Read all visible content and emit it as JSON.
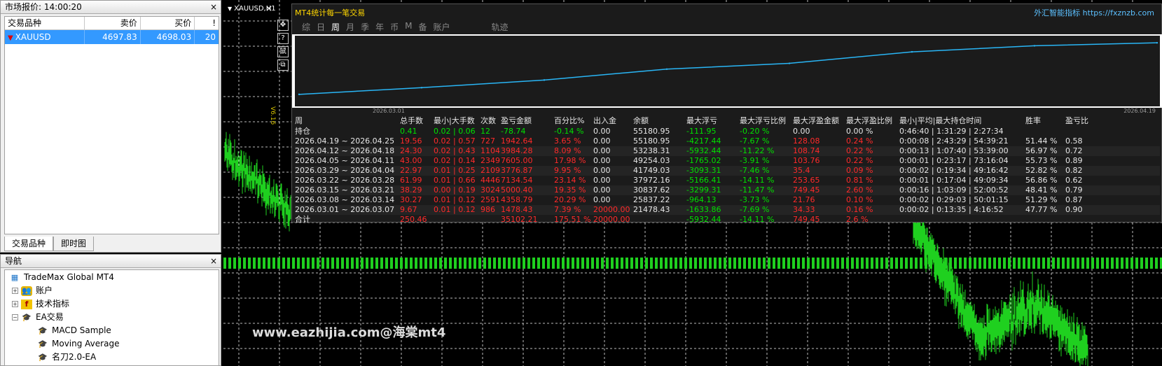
{
  "market": {
    "title": "市场报价: 14:00:20",
    "close": "×",
    "cols": [
      "交易品种",
      "卖价",
      "买价",
      "!"
    ],
    "row": {
      "symbol": "XAUUSD",
      "bid": "4697.83",
      "ask": "4698.03",
      "spread": "20"
    },
    "tabs": [
      "交易品种",
      "即时图"
    ]
  },
  "nav": {
    "title": "导航",
    "close": "×",
    "root": "TradeMax Global MT4",
    "account": "账户",
    "indicators": "技术指标",
    "ea": "EA交易",
    "ea_items": [
      "MACD Sample",
      "Moving Average",
      "名刀2.0-EA"
    ]
  },
  "chart": {
    "symbol": "XAUUSD,H1",
    "close": "×",
    "version": "V6.16",
    "watermark": "www.eazhijia.com@海棠mt4",
    "tools": [
      "✥",
      "?",
      "鼠",
      "⧉"
    ]
  },
  "stats": {
    "title": "MT4统计每一笔交易",
    "brand": "外汇智能指标 https://fxznzb.com",
    "tabs": [
      "综",
      "日",
      "周",
      "月",
      "季",
      "年",
      "币",
      "M",
      "备",
      "账户"
    ],
    "tab_track": "轨迹",
    "active_tab": "周",
    "date_start": "2026.03.01",
    "date_end": "2026.04.19",
    "headers": [
      "周",
      "总手数",
      "最小|大手数",
      "次数",
      "盈亏金额",
      "百分比%",
      "出入金",
      "余额",
      "最大浮亏",
      "最大浮亏比例",
      "最大浮盈金额",
      "最大浮盈比例",
      "最小|平均|最大持仓时间",
      "胜率",
      "盈亏比"
    ],
    "holding": [
      "持仓",
      "0.41",
      "0.02 | 0.06",
      "12",
      "-78.74",
      "-0.14 %",
      "0.00",
      "55180.95",
      "-111.95",
      "-0.20 %",
      "0.00",
      "0.00 %",
      "0:46:40 | 1:31:29 | 2:27:34",
      "",
      ""
    ],
    "rows": [
      [
        "2026.04.19 ~ 2026.04.25",
        "19.56",
        "0.02 | 0.57",
        "727",
        "1942.64",
        "3.65 %",
        "0.00",
        "55180.95",
        "-4217.44",
        "-7.67 %",
        "128.08",
        "0.24 %",
        "0:00:08 | 2:43:29 | 54:39:21",
        "51.44 %",
        "0.58"
      ],
      [
        "2026.04.12 ~ 2026.04.18",
        "24.30",
        "0.02 | 0.43",
        "1104",
        "3984.28",
        "8.09 %",
        "0.00",
        "53238.31",
        "-5932.44",
        "-11.22 %",
        "108.74",
        "0.22 %",
        "0:00:13 | 1:07:40 | 53:39:00",
        "56.97 %",
        "0.72"
      ],
      [
        "2026.04.05 ~ 2026.04.11",
        "43.00",
        "0.02 | 0.14",
        "2349",
        "7605.00",
        "17.98 %",
        "0.00",
        "49254.03",
        "-1765.02",
        "-3.91 %",
        "103.76",
        "0.22 %",
        "0:00:01 | 0:23:17 | 73:16:04",
        "55.73 %",
        "0.89"
      ],
      [
        "2026.03.29 ~ 2026.04.04",
        "22.97",
        "0.01 | 0.25",
        "2109",
        "3776.87",
        "9.95 %",
        "0.00",
        "41749.03",
        "-3093.31",
        "-7.46 %",
        "35.4",
        "0.09 %",
        "0:00:02 | 0:19:34 | 49:16:42",
        "52.82 %",
        "0.82"
      ],
      [
        "2026.03.22 ~ 2026.03.28",
        "61.99",
        "0.01 | 0.66",
        "4446",
        "7134.54",
        "23.14 %",
        "0.00",
        "37972.16",
        "-5166.41",
        "-14.11 %",
        "253.65",
        "0.81 %",
        "0:00:01 | 0:17:04 | 49:09:34",
        "56.86 %",
        "0.62"
      ],
      [
        "2026.03.15 ~ 2026.03.21",
        "38.29",
        "0.00 | 0.19",
        "3024",
        "5000.40",
        "19.35 %",
        "0.00",
        "30837.62",
        "-3299.31",
        "-11.47 %",
        "749.45",
        "2.60 %",
        "0:00:16 | 1:03:09 | 52:00:52",
        "48.41 %",
        "0.79"
      ],
      [
        "2026.03.08 ~ 2026.03.14",
        "30.27",
        "0.01 | 0.12",
        "2591",
        "4358.79",
        "20.29 %",
        "0.00",
        "25837.22",
        "-964.13",
        "-3.73 %",
        "21.76",
        "0.10 %",
        "0:00:02 | 0:29:03 | 50:01:15",
        "51.29 %",
        "0.87"
      ],
      [
        "2026.03.01 ~ 2026.03.07",
        "9.67",
        "0.01 | 0.12",
        "986",
        "1478.43",
        "7.39 %",
        "20000.00",
        "21478.43",
        "-1633.86",
        "-7.69 %",
        "34.33",
        "0.16 %",
        "0:00:02 | 0:13:35 | 4:16:52",
        "47.77 %",
        "0.90"
      ]
    ],
    "total": [
      "合计",
      "250.46",
      "",
      "",
      "35102.21",
      "175.51 %",
      "20000.00",
      "",
      "-5932.44",
      "-14.11 %",
      "749.45",
      "2.6 %",
      "",
      "",
      ""
    ]
  },
  "chart_data": {
    "type": "line",
    "x": [
      "2026.03.01",
      "2026.03.08",
      "2026.03.15",
      "2026.03.22",
      "2026.03.29",
      "2026.04.05",
      "2026.04.12",
      "2026.04.19"
    ],
    "values": [
      21478.43,
      25837.22,
      30837.62,
      37972.16,
      41749.03,
      49254.03,
      53238.31,
      55180.95
    ],
    "ylim": [
      15000,
      58000
    ],
    "grid": false,
    "color": "#29b6f6"
  },
  "colors": {
    "green": "#00e000",
    "red": "#ff2a2a",
    "candle": "#1fd01f",
    "selection": "#3399ff"
  }
}
